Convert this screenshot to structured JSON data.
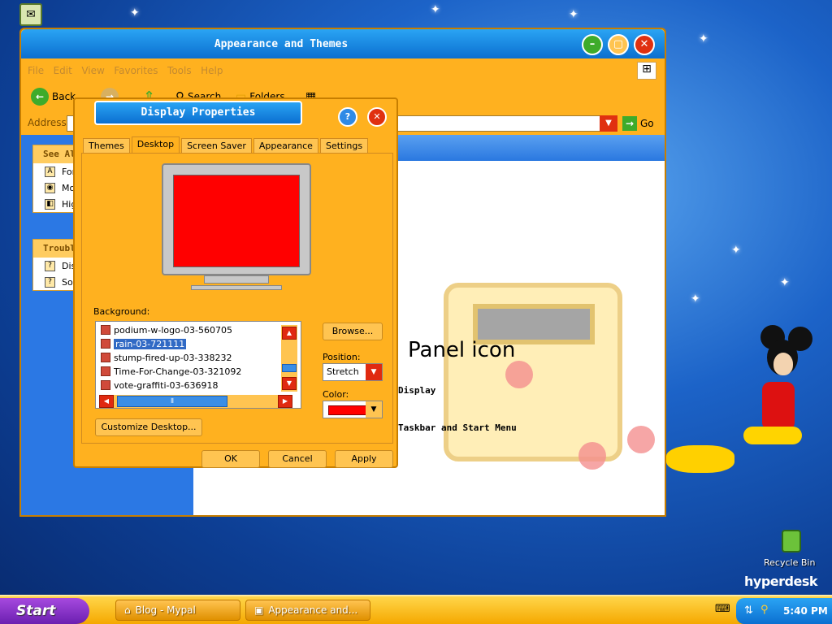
{
  "desktop": {
    "recycle_bin_label": "Recycle Bin",
    "brand": "hyperdesk"
  },
  "explorer": {
    "title": "Appearance and Themes",
    "menu": [
      "File",
      "Edit",
      "View",
      "Favorites",
      "Tools",
      "Help"
    ],
    "toolbar": {
      "back": "Back",
      "search": "Search",
      "folders": "Folders"
    },
    "address_label": "Address",
    "go_label": "Go",
    "see_also": {
      "header": "See Also",
      "items": [
        "Fonts",
        "Mouse Pointers",
        "High Contrast"
      ]
    },
    "troubleshooters": {
      "header": "Troubleshooters",
      "items": [
        "Display",
        "Sound"
      ]
    },
    "content_heading": "Panel icon",
    "content_line1": "Display",
    "content_line2": "Taskbar and Start Menu"
  },
  "dialog": {
    "title": "Display Properties",
    "tabs": [
      "Themes",
      "Desktop",
      "Screen Saver",
      "Appearance",
      "Settings"
    ],
    "active_tab": "Desktop",
    "background_label": "Background:",
    "backgrounds": [
      "podium-w-logo-03-560705",
      "rain-03-721111",
      "stump-fired-up-03-338232",
      "Time-For-Change-03-321092",
      "vote-graffiti-03-636918"
    ],
    "selected_background": "rain-03-721111",
    "browse_label": "Browse...",
    "position_label": "Position:",
    "position_value": "Stretch",
    "color_label": "Color:",
    "color_value": "#ff0000",
    "customize_label": "Customize Desktop...",
    "ok_label": "OK",
    "cancel_label": "Cancel",
    "apply_label": "Apply"
  },
  "taskbar": {
    "start_label": "Start",
    "tasks": [
      "Blog - Mypal",
      "Appearance and..."
    ],
    "clock": "5:40 PM"
  }
}
